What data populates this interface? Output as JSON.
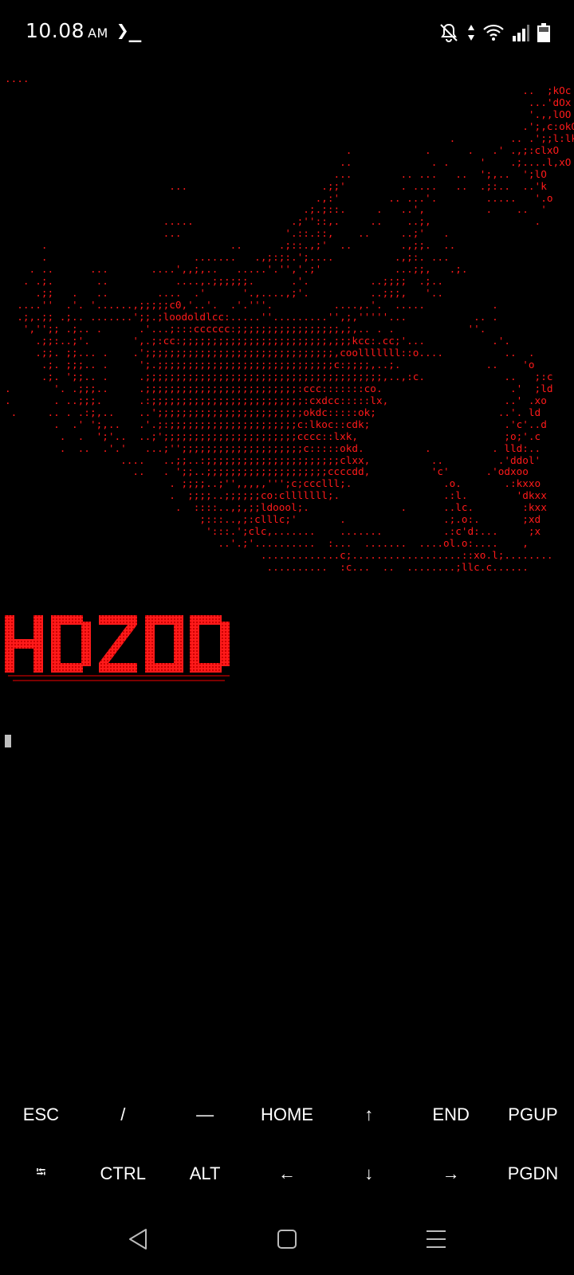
{
  "status_bar": {
    "time": "10.08",
    "ampm": "AM",
    "app_icon": "terminal-prompt-icon",
    "icons": [
      "notifications-off-icon",
      "data-arrows-icon",
      "wifi-icon",
      "signal-icon",
      "battery-icon"
    ]
  },
  "terminal": {
    "ascii_art": "....\n                                                                                     ..  ;kOc\n                                                                                      ...'dOx\n                                                                                      '.,,lOO\n                                                                                     .';,c:okO\n                                                                         .         .. .';;l:lkO\n                                                        .            .      .   .' .,;:clxO\n                                                       ..             . .     '    .;....l,xO\n                                                      ...        .. ...   ..  ';,..  ';lO\n                           ...                      .;;'         . ....   ..  .;:..  ..'k\n                                                   .,:'        .. ...'.        .....   '.o\n                                                 .;.;::.     .   ..',          .    ..  '\n                          .....                .;''::,.     ..    ..;,                 .\n                          ...                 '.::.::,    ..     ..;'   .\n      .                              ..      .;::.,;'  ..        .,;;.  ..\n      .                        .......   .,;:;:.';....          .,;:. ...\n    . ..      ...       ....',,;,..   .....'.'','.;'            ...;;,   .;.\n   . .;.       ..           ....,.;;;;;;.      .'.          ..;;;;  .;..\n     .;;   .   ..        ....  .'      '.,....,;'.          ..;;;,   '..\n  ....''  .'. '......,;;;;;c0,'..'.  .'.'''.          ....,.'.  .....           .\n  .;,.;; .;.. .......';;.;loodoldlcc:.....''.........'',;,'''''...           .. .\n   ','';; .;.. .      .'...;:::cccccc:;;;;;;;;;;;;;;;;;,;,.. . .            ''.\n     .;;:..;'.       ',.;:cc:;;;;;;;;;;;;;;;;;;;;;;;;,;;;kcc:.cc;'...           .'.\n     .;;. ;;... .    .';;;;;;;;;;;;;;;;;;;;;;;;;;;;;;;,coolllllll::o....          ..  .\n      .;. ;;;.. .     ';.;;;;;;;;;;;;;;;;;;;;;;;;;;;;;c:;;;;,..;.              ..    'o\n      .;. ';;.. .     .;;;;;;;;;;;;;;;;;;;;;;;;;;;;;;;;;;;;;;;,..,:c.             ..   ;:c\n.       '. .;;;..     .;;;;;;;;;;;;;;;;;;;;;;;;;:ccc:::::::co.                     .'  ;ld\n.       . ..;;;.      .:;;;;;;;;;;;;;;;;;;;;;;;;;:cxdcc:::::lx,                   ..' .xo\n .     .. . .:;,..    ..';;;;;;;;;;;;;;;;;;;;;;;;okdc:::::ok;                    ..'. ld\n        .  .' ';,..   .'.;:;;;;;;;;;;;;;;;;;;;;;c:lkoc::cdk;                      .'c'..d\n         .  .  ';'..  ..;';;;;;;;;;;;;;;;;;;;;;;cccc::lxk,                        ;o;'.c\n         .  ..  .'.'   ...;'';;;;;;;;;;;;;;;;;;;;c:::::okd.          .          . lld:..\n                   ....   ..;;..:;;;;;;;;;;;;;;;;;;;;;;clxx,          ..         .'ddol'\n                     ..   . ';;..;;;;;;;;;;;;;;;;;;;;ccccdd,          'c'      .'odxoo\n                           . ;;;;..;'',,,,,''';c;ccclll;.               .o.       .:kxxo\n                           .  ;;;;..;;;;;;co:clllllll;.                 .:l.        'dkxx\n                            .  ::::..,;,;;ldoool;.               .      ..lc.        :kxx\n                                ;:::..,;:clllc;'       .                .;.o:.       ;xd\n                                 ':::.';clc,.......    .......          .:c'd:...     ;x\n                                   ..'.;'..........  :...  .......  ....ol.o:....    ,\n                                          .............c;..................::xo.l;........\n                                           ..........  :c...  ..  ........;llc.c......",
    "banner_text": "HDZOD",
    "banner_color": "#ff1a1a"
  },
  "extra_keys": {
    "row1": [
      "ESC",
      "/",
      "—",
      "HOME",
      "↑",
      "END",
      "PGUP"
    ],
    "row2": [
      "⭾",
      "CTRL",
      "ALT",
      "←",
      "↓",
      "→",
      "PGDN"
    ]
  },
  "nav_bar": {
    "icons": [
      "back-icon",
      "home-icon",
      "recents-icon"
    ]
  },
  "colors": {
    "background": "#000000",
    "art": "#ff1a1a",
    "text": "#ffffff"
  }
}
